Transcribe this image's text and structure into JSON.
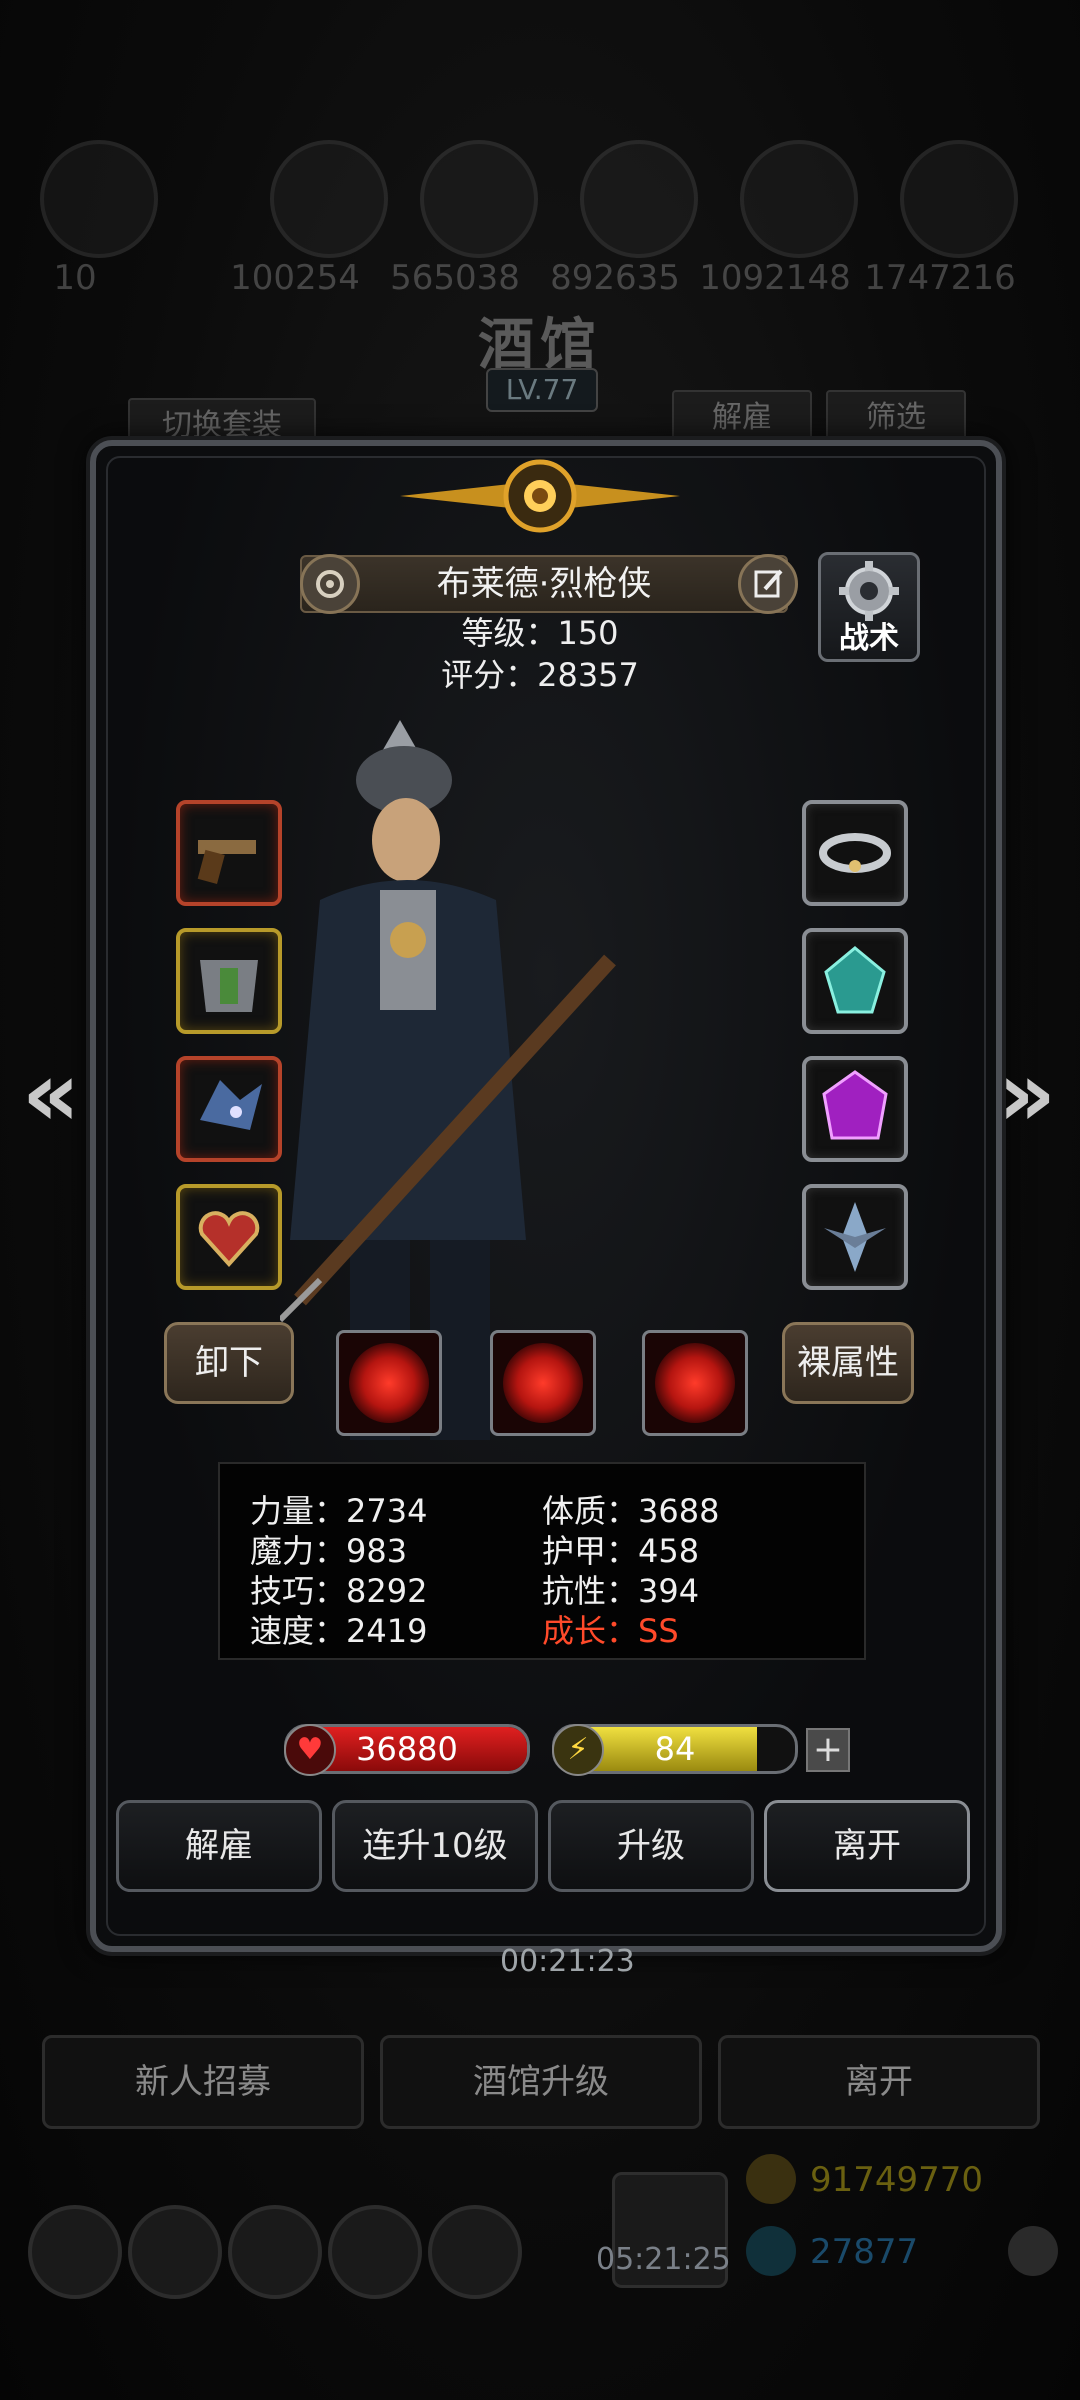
{
  "background": {
    "resources": [
      "10",
      "100254",
      "565038",
      "892635",
      "1092148",
      "1747216"
    ],
    "title": "酒馆",
    "level": "LV.77",
    "switch_outfit_label": "切换套装",
    "dismiss_label": "解雇",
    "filter_label": "筛选",
    "timer": "00:21:23",
    "bottom_buttons": [
      "新人招募",
      "酒馆升级",
      "离开"
    ],
    "gold": "91749770",
    "gems": "27877",
    "bottom_timer": "05:21:25"
  },
  "hero": {
    "name": "布莱德·烈枪侠",
    "level_label": "等级：150",
    "score_label": "评分：28357",
    "tactics_label": "战术"
  },
  "equipment": {
    "left": [
      {
        "name": "pistol-slot",
        "icon": "pistol-icon",
        "rarity": "red"
      },
      {
        "name": "armor-slot",
        "icon": "armor-icon",
        "rarity": "gold"
      },
      {
        "name": "dragon-slot",
        "icon": "dragon-helm-icon",
        "rarity": "red"
      },
      {
        "name": "amulet-slot",
        "icon": "heart-amulet-icon",
        "rarity": "gold"
      }
    ],
    "right": [
      {
        "name": "ring-slot",
        "icon": "ring-icon",
        "rarity": "gray"
      },
      {
        "name": "teal-gem-slot",
        "icon": "teal-gem-icon",
        "rarity": "gray"
      },
      {
        "name": "purple-gem-slot",
        "icon": "purple-gem-icon",
        "rarity": "gray"
      },
      {
        "name": "emblem-slot",
        "icon": "crystal-emblem-icon",
        "rarity": "gray"
      }
    ]
  },
  "actions": {
    "unequip_label": "卸下",
    "base_attr_label": "裸属性"
  },
  "skills": [
    "crosshair-skill-icon",
    "vortex-skill-icon",
    "target-skill-icon"
  ],
  "stats": {
    "col1": [
      "力量：2734",
      "魔力：983",
      "技巧：8292",
      "速度：2419"
    ],
    "col2": [
      "体质：3688",
      "护甲：458",
      "抗性：394",
      "成长：SS"
    ]
  },
  "hp": {
    "value": "36880",
    "fill_fraction": 1.0
  },
  "energy": {
    "value": "84",
    "fill_fraction": 0.84
  },
  "buttons": {
    "dismiss": "解雇",
    "level10": "连升10级",
    "upgrade": "升级",
    "leave": "离开"
  },
  "colors": {
    "hp": "#c8141a",
    "energy": "#d8c81c",
    "accent_red": "#ff4a2a"
  }
}
